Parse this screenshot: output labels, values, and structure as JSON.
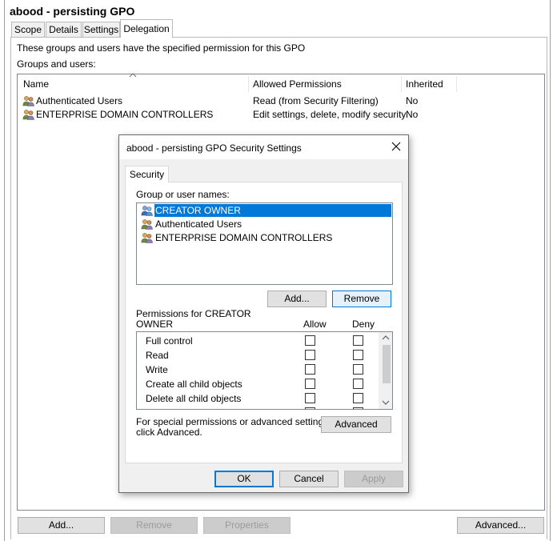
{
  "window": {
    "title": "abood - persisting GPO"
  },
  "tabs": [
    {
      "label": "Scope"
    },
    {
      "label": "Details"
    },
    {
      "label": "Settings"
    },
    {
      "label": "Delegation"
    }
  ],
  "delegation": {
    "intro": "These groups and users have the specified permission for this GPO",
    "groups_label": "Groups and users:",
    "columns": [
      "Name",
      "Allowed Permissions",
      "Inherited"
    ],
    "rows": [
      {
        "name": "Authenticated Users",
        "permissions": "Read (from Security Filtering)",
        "inherited": "No"
      },
      {
        "name": "ENTERPRISE DOMAIN CONTROLLERS",
        "permissions": "Edit settings, delete, modify security",
        "inherited": "No"
      }
    ],
    "buttons": {
      "add": "Add...",
      "remove": "Remove",
      "properties": "Properties",
      "advanced": "Advanced..."
    }
  },
  "dialog": {
    "title": "abood - persisting GPO Security Settings",
    "tab": "Security",
    "group_label": "Group or user names:",
    "names": [
      {
        "name": "CREATOR OWNER",
        "selected": true
      },
      {
        "name": "Authenticated Users",
        "selected": false
      },
      {
        "name": "ENTERPRISE DOMAIN CONTROLLERS",
        "selected": false
      }
    ],
    "add_button": "Add...",
    "remove_button": "Remove",
    "permissions_label_line1": "Permissions for CREATOR",
    "permissions_label_line2": "OWNER",
    "allow_label": "Allow",
    "deny_label": "Deny",
    "permissions": [
      {
        "name": "Full control",
        "allow": false,
        "deny": false
      },
      {
        "name": "Read",
        "allow": false,
        "deny": false
      },
      {
        "name": "Write",
        "allow": false,
        "deny": false
      },
      {
        "name": "Create all child objects",
        "allow": false,
        "deny": false
      },
      {
        "name": "Delete all child objects",
        "allow": false,
        "deny": false
      }
    ],
    "special_line1": "For special permissions or advanced settings,",
    "special_line2": "click Advanced.",
    "advanced_button": "Advanced",
    "ok_button": "OK",
    "cancel_button": "Cancel",
    "apply_button": "Apply"
  },
  "colors": {
    "selection": "#0078d7",
    "focus_border": "#0078d7",
    "button_face": "#e1e1e1",
    "disabled_face": "#cccccc"
  },
  "icons": {
    "group_users": "group-users-icon",
    "close": "close-icon",
    "sort_ascending": "sort-ascending-icon",
    "scroll_up": "scroll-up-arrow-icon",
    "scroll_down": "scroll-down-arrow-icon"
  }
}
